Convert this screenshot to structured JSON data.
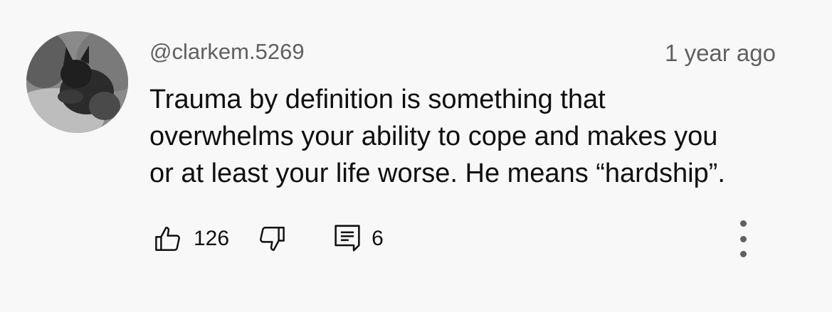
{
  "comment": {
    "author": "@clarkem.5269",
    "timestamp": "1 year ago",
    "text_lines": [
      "Trauma by definition is something that",
      "overwhelms your ability to cope and makes you",
      "or at least your life worse. He means “hardship”."
    ],
    "likes": "126",
    "replies": "6"
  },
  "icons": {
    "avatar": "avatar-cat-photo",
    "like": "thumbs-up-icon",
    "dislike": "thumbs-down-icon",
    "reply": "comment-icon",
    "more": "more-vertical-icon"
  },
  "colors": {
    "background": "#f8f8f8",
    "text_primary": "#0f0f0f",
    "text_secondary": "#606060"
  }
}
